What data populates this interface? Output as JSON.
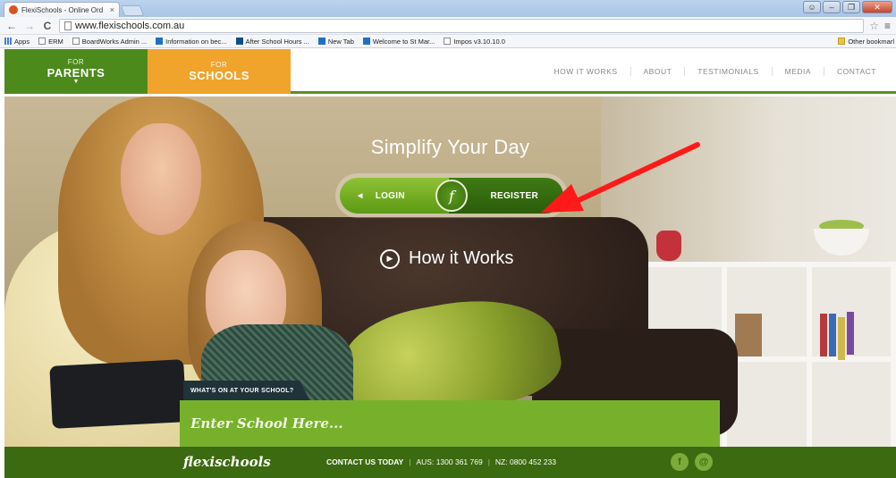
{
  "browser": {
    "tab_title": "FlexiSchools - Online Ord",
    "tab_close": "×",
    "url": "www.flexischools.com.au",
    "bookmarks": [
      {
        "label": "Apps",
        "icon": "apps-icon"
      },
      {
        "label": "ERM",
        "icon": "page-icon"
      },
      {
        "label": "BoardWorks Admin ...",
        "icon": "page-icon"
      },
      {
        "label": "Information on bec...",
        "icon": "site-icon"
      },
      {
        "label": "After School Hours ...",
        "icon": "pc-icon"
      },
      {
        "label": "New Tab",
        "icon": "site-icon"
      },
      {
        "label": "Welcome to St Mar...",
        "icon": "site-icon"
      },
      {
        "label": "Impos v3.10.10.0",
        "icon": "page-icon"
      }
    ],
    "other_bookmarks": "Other bookmarl"
  },
  "header": {
    "parents_small": "FOR",
    "parents_big": "PARENTS",
    "schools_small": "FOR",
    "schools_big": "SCHOOLS",
    "nav": [
      "HOW IT WORKS",
      "ABOUT",
      "TESTIMONIALS",
      "MEDIA",
      "CONTACT"
    ],
    "brand_color": "#4c8a1c",
    "accent_color": "#f0a42b"
  },
  "hero": {
    "headline": "Simplify Your Day",
    "login_label": "LOGIN",
    "register_label": "REGISTER",
    "how_it_works": "How it Works",
    "school_label": "WHAT'S ON AT YOUR SCHOOL?",
    "school_placeholder": "Enter School Here...",
    "arrow_color": "#ff1a1a"
  },
  "footer": {
    "brand": "flexischools",
    "contact_label": "CONTACT US TODAY",
    "aus": "AUS: 1300 361 769",
    "nz": "NZ: 0800 452 233",
    "separator": "|"
  }
}
